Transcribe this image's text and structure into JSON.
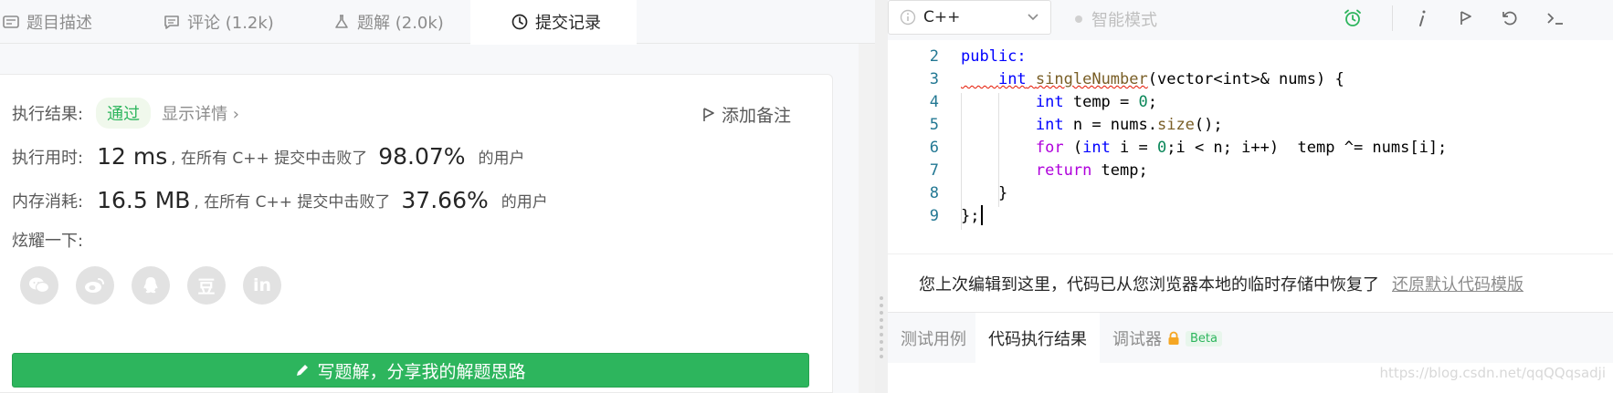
{
  "left": {
    "tabs": [
      {
        "label": "题目描述",
        "icon": "description-icon"
      },
      {
        "label": "评论 (1.2k)",
        "icon": "comment-icon"
      },
      {
        "label": "题解 (2.0k)",
        "icon": "flask-icon"
      },
      {
        "label": "提交记录",
        "icon": "clock-icon"
      }
    ],
    "result": {
      "label": "执行结果:",
      "status": "通过",
      "details": "显示详情 ›",
      "add_note": "添加备注"
    },
    "runtime": {
      "label": "执行用时:",
      "value": "12 ms",
      "text1": ", 在所有 C++ 提交中击败了",
      "percent": "98.07%",
      "text2": "的用户"
    },
    "memory": {
      "label": "内存消耗:",
      "value": "16.5 MB",
      "text1": ", 在所有 C++ 提交中击败了",
      "percent": "37.66%",
      "text2": "的用户"
    },
    "share": {
      "label": "炫耀一下:",
      "icons": [
        "wechat-icon",
        "weibo-icon",
        "qq-icon",
        "douban-icon",
        "linkedin-icon"
      ],
      "douban_glyph": "豆",
      "linkedin_glyph": "in"
    },
    "write_button": "写题解，分享我的解题思路"
  },
  "right": {
    "language": "C++",
    "smart_mode": "智能模式",
    "code": {
      "line_numbers": [
        "2",
        "3",
        "4",
        "5",
        "6",
        "7",
        "8",
        "9"
      ],
      "lines": [
        {
          "pre": "",
          "kw": "public:",
          "rest": ""
        },
        {
          "indent": "    ",
          "type": "int",
          "fn": "singleNumber",
          "rest": "(vector<int>& nums) {"
        },
        {
          "indent": "        ",
          "type": "int",
          "rest": " temp = ",
          "num": "0",
          "tail": ";"
        },
        {
          "indent": "        ",
          "type": "int",
          "rest": " n = nums.",
          "fn": "size",
          "tail": "();"
        },
        {
          "indent": "        ",
          "kw": "for",
          "rest": " (",
          "type": "int",
          "rest2": " i = ",
          "num": "0",
          "tail": ";i < n; i++)  temp ^= nums[i];"
        },
        {
          "indent": "        ",
          "kw": "return",
          "rest": " temp;"
        },
        {
          "indent": "    ",
          "rest": "}"
        },
        {
          "rest": "};"
        }
      ]
    },
    "restore": {
      "message": "您上次编辑到这里，代码已从您浏览器本地的临时存储中恢复了",
      "link": "还原默认代码模版"
    },
    "bottom_tabs": [
      "测试用例",
      "代码执行结果",
      "调试器"
    ],
    "beta": "Beta",
    "watermark": "https://blog.csdn.net/qqQQqsadji"
  }
}
